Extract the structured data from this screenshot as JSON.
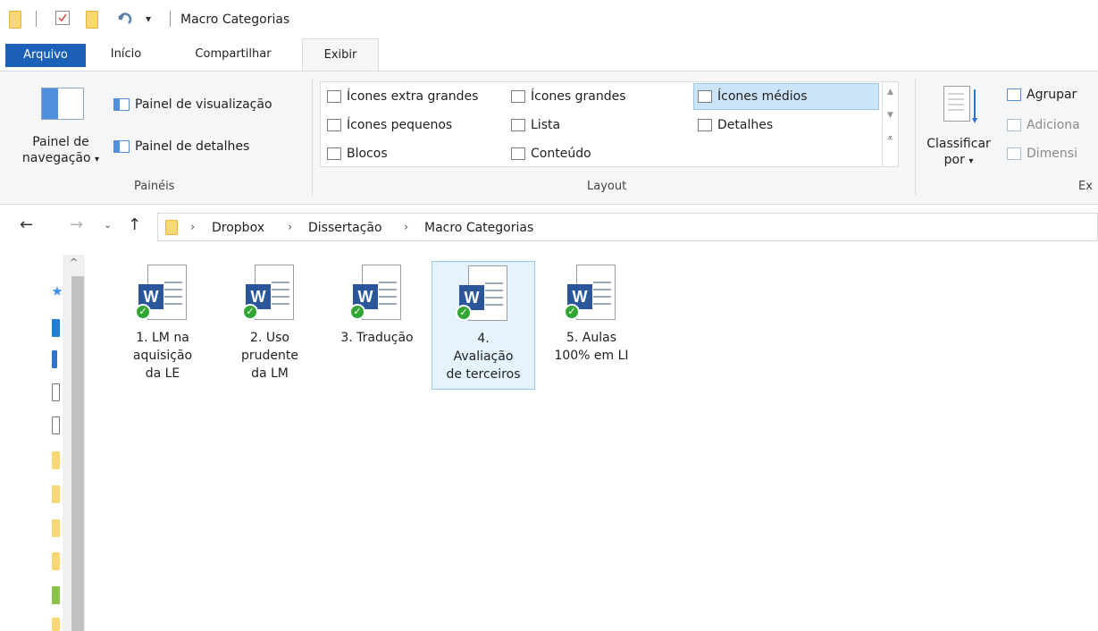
{
  "window": {
    "title": "Macro Categorias"
  },
  "tabs": [
    {
      "label": "Arquivo"
    },
    {
      "label": "Início"
    },
    {
      "label": "Compartilhar"
    },
    {
      "label": "Exibir"
    }
  ],
  "ribbon": {
    "panels_group": {
      "label": "Painéis",
      "nav_pane_line1": "Painel de",
      "nav_pane_line2": "navegação",
      "preview_pane": "Painel de visualização",
      "details_pane": "Painel de detalhes"
    },
    "layout_group": {
      "label": "Layout",
      "items": [
        {
          "label": "Ícones extra grandes"
        },
        {
          "label": "Ícones grandes"
        },
        {
          "label": "Ícones médios"
        },
        {
          "label": "Ícones pequenos"
        },
        {
          "label": "Lista"
        },
        {
          "label": "Detalhes"
        },
        {
          "label": "Blocos"
        },
        {
          "label": "Conteúdo"
        }
      ],
      "selected": "Ícones médios"
    },
    "current_view_group": {
      "label": "Ex",
      "sort_line1": "Classificar",
      "sort_line2": "por",
      "group_by": "Agrupar",
      "add_columns": "Adiciona",
      "size_columns": "Dimensi"
    }
  },
  "address": {
    "crumbs": [
      {
        "label": "Dropbox"
      },
      {
        "label": "Dissertação"
      },
      {
        "label": "Macro Categorias"
      }
    ]
  },
  "files": [
    {
      "name": "1. LM na aquisição da LE",
      "lines": [
        "1. LM na",
        "aquisição",
        "da LE"
      ]
    },
    {
      "name": "2. Uso prudente da LM",
      "lines": [
        "2. Uso",
        "prudente",
        "da LM"
      ]
    },
    {
      "name": "3. Tradução",
      "lines": [
        "3. Tradução"
      ]
    },
    {
      "name": "4. Avaliação de terceiros",
      "lines": [
        "4.",
        "Avaliação",
        "de terceiros"
      ]
    },
    {
      "name": "5. Aulas 100% em LI",
      "lines": [
        "5. Aulas",
        "100% em LI"
      ]
    }
  ],
  "colors": {
    "file_tab": "#1c61b7",
    "word_blue": "#2b579a",
    "sync_green": "#33a534",
    "selection": "#cce4f7"
  }
}
